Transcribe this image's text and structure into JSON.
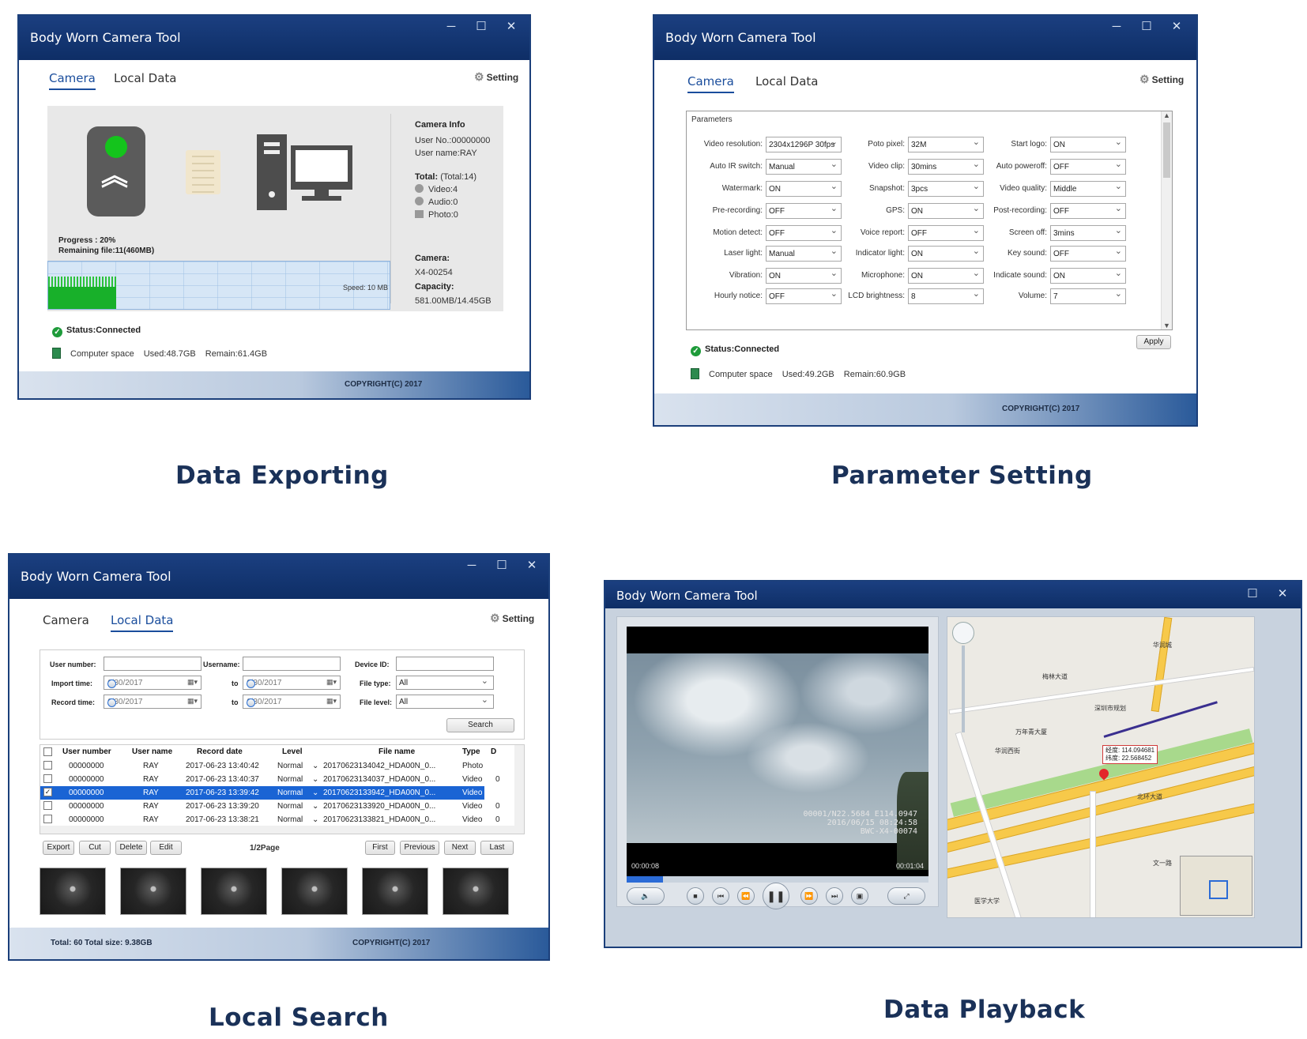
{
  "app_title": "Body Worn Camera Tool",
  "window_controls": {
    "minimize": "─",
    "maximize": "☐",
    "close": "✕"
  },
  "tabs": {
    "camera": "Camera",
    "local_data": "Local Data"
  },
  "setting_label": "Setting",
  "copyright": "COPYRIGHT(C) 2017",
  "captions": {
    "w1": "Data Exporting",
    "w2": "Parameter Setting",
    "w3": "Local Search",
    "w4": "Data Playback"
  },
  "w1": {
    "progress": "Progress : 20%",
    "progress_value": 0.2,
    "remaining": "Remaining file:11(460MB)",
    "speed": "Speed: 10 MB",
    "camera_info_title": "Camera Info",
    "user_no": "User No.:00000000",
    "user_name": "User name:RAY",
    "total_label": "Total:",
    "total_value": "(Total:14)",
    "video": "Video:4",
    "audio": "Audio:0",
    "photo": "Photo:0",
    "camera_label": "Camera:",
    "camera_value": "X4-00254",
    "capacity_label": "Capacity:",
    "capacity_value": "581.00MB/14.45GB",
    "status": "Status:Connected",
    "space_label": "Computer space",
    "used": "Used:48.7GB",
    "remain": "Remain:61.4GB"
  },
  "w2": {
    "legend": "Parameters",
    "params": [
      {
        "label": "Video resolution:",
        "value": "2304x1296P 30fps"
      },
      {
        "label": "Auto IR switch:",
        "value": "Manual"
      },
      {
        "label": "Watermark:",
        "value": "ON"
      },
      {
        "label": "Pre-recording:",
        "value": "OFF"
      },
      {
        "label": "Motion detect:",
        "value": "OFF"
      },
      {
        "label": "Laser light:",
        "value": "Manual"
      },
      {
        "label": "Vibration:",
        "value": "ON"
      },
      {
        "label": "Hourly notice:",
        "value": "OFF"
      },
      {
        "label": "Poto pixel:",
        "value": "32M"
      },
      {
        "label": "Video clip:",
        "value": "30mins"
      },
      {
        "label": "Snapshot:",
        "value": "3pcs"
      },
      {
        "label": "GPS:",
        "value": "ON"
      },
      {
        "label": "Voice report:",
        "value": "OFF"
      },
      {
        "label": "Indicator light:",
        "value": "ON"
      },
      {
        "label": "Microphone:",
        "value": "ON"
      },
      {
        "label": "LCD brightness:",
        "value": "8"
      },
      {
        "label": "Start logo:",
        "value": "ON"
      },
      {
        "label": "Auto poweroff:",
        "value": "OFF"
      },
      {
        "label": "Video quality:",
        "value": "Middle"
      },
      {
        "label": "Post-recording:",
        "value": "OFF"
      },
      {
        "label": "Screen off:",
        "value": "3mins"
      },
      {
        "label": "Key sound:",
        "value": "OFF"
      },
      {
        "label": "Indicate sound:",
        "value": "ON"
      },
      {
        "label": "Volume:",
        "value": "7"
      }
    ],
    "apply": "Apply",
    "status": "Status:Connected",
    "space_label": "Computer space",
    "used": "Used:49.2GB",
    "remain": "Remain:60.9GB"
  },
  "w3": {
    "labels": {
      "user_number": "User number:",
      "username": "Username:",
      "device_id": "Device ID:",
      "import_time": "Import time:",
      "record_time": "Record time:",
      "to": "to",
      "file_type": "File type:",
      "file_level": "File level:"
    },
    "date_value": "6/30/2017",
    "file_type_value": "All",
    "file_level_value": "All",
    "search": "Search",
    "columns": [
      "User number",
      "User name",
      "Record date",
      "Level",
      "File name",
      "Type",
      "D"
    ],
    "rows": [
      {
        "checked": false,
        "selected": false,
        "user_number": "00000000",
        "user_name": "RAY",
        "record_date": "2017-06-23 13:40:42",
        "level": "Normal",
        "file_name": "20170623134042_HDA00N_0...",
        "type": "Photo",
        "d": ""
      },
      {
        "checked": false,
        "selected": false,
        "user_number": "00000000",
        "user_name": "RAY",
        "record_date": "2017-06-23 13:40:37",
        "level": "Normal",
        "file_name": "20170623134037_HDA00N_0...",
        "type": "Video",
        "d": "0"
      },
      {
        "checked": true,
        "selected": true,
        "user_number": "00000000",
        "user_name": "RAY",
        "record_date": "2017-06-23 13:39:42",
        "level": "Normal",
        "file_name": "20170623133942_HDA00N_0...",
        "type": "Video",
        "d": "0"
      },
      {
        "checked": false,
        "selected": false,
        "user_number": "00000000",
        "user_name": "RAY",
        "record_date": "2017-06-23 13:39:20",
        "level": "Normal",
        "file_name": "20170623133920_HDA00N_0...",
        "type": "Video",
        "d": "0"
      },
      {
        "checked": false,
        "selected": false,
        "user_number": "00000000",
        "user_name": "RAY",
        "record_date": "2017-06-23 13:38:21",
        "level": "Normal",
        "file_name": "20170623133821_HDA00N_0...",
        "type": "Video",
        "d": "0"
      }
    ],
    "buttons": {
      "export": "Export",
      "cut": "Cut",
      "delete": "Delete",
      "edit": "Edit",
      "first": "First",
      "previous": "Previous",
      "next": "Next",
      "last": "Last"
    },
    "page": "1/2Page",
    "footer_total": "Total: 60 Total size: 9.38GB"
  },
  "w4": {
    "overlay_line1": "00001/N22.5684 E114.0947",
    "overlay_line2": "2016/06/15 08:24:58",
    "overlay_line3": "BWC-X4-00074",
    "time_elapsed": "00:00:08",
    "time_total": "00:01:04",
    "playback_progress": 0.12,
    "map_tip_line1": "经度: 114.094681",
    "map_tip_line2": "纬度: 22.568452",
    "map_labels": [
      "万年青大厦",
      "华润西街",
      "北环大道",
      "深圳市规划",
      "医学大学",
      "文一路",
      "梅林大道",
      "华润城"
    ]
  }
}
